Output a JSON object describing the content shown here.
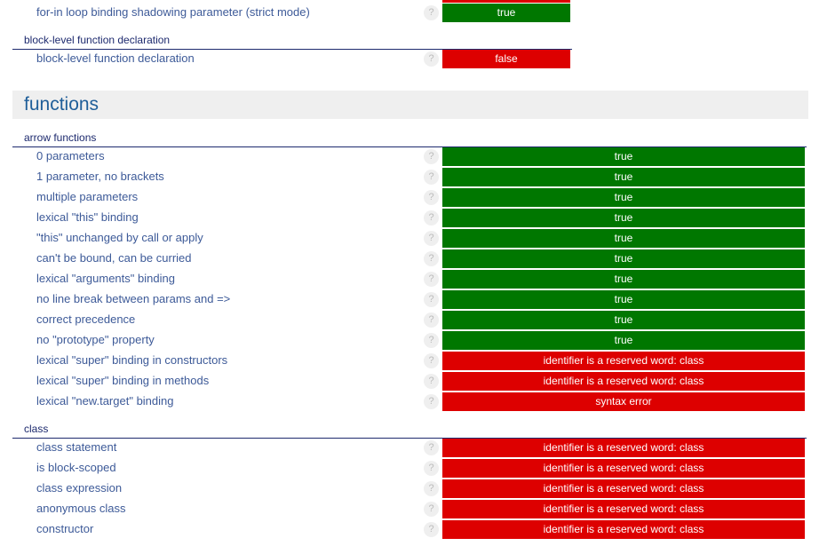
{
  "top": {
    "rows": [
      {
        "label": "for-in loop binding shadowing parameter (strict mode)",
        "result": "true",
        "status": "pass"
      }
    ]
  },
  "block_level": {
    "heading": "block-level function declaration",
    "rows": [
      {
        "label": "block-level function declaration",
        "result": "false",
        "status": "fail"
      }
    ]
  },
  "section": {
    "title": "functions"
  },
  "arrow_functions": {
    "heading": "arrow functions",
    "rows": [
      {
        "label": "0 parameters",
        "result": "true",
        "status": "pass"
      },
      {
        "label": "1 parameter, no brackets",
        "result": "true",
        "status": "pass"
      },
      {
        "label": "multiple parameters",
        "result": "true",
        "status": "pass"
      },
      {
        "label": "lexical \"this\" binding",
        "result": "true",
        "status": "pass"
      },
      {
        "label": "\"this\" unchanged by call or apply",
        "result": "true",
        "status": "pass"
      },
      {
        "label": "can't be bound, can be curried",
        "result": "true",
        "status": "pass"
      },
      {
        "label": "lexical \"arguments\" binding",
        "result": "true",
        "status": "pass"
      },
      {
        "label": "no line break between params and =>",
        "result": "true",
        "status": "pass"
      },
      {
        "label": "correct precedence",
        "result": "true",
        "status": "pass"
      },
      {
        "label": "no \"prototype\" property",
        "result": "true",
        "status": "pass"
      },
      {
        "label": "lexical \"super\" binding in constructors",
        "result": "identifier is a reserved word: class",
        "status": "fail"
      },
      {
        "label": "lexical \"super\" binding in methods",
        "result": "identifier is a reserved word: class",
        "status": "fail"
      },
      {
        "label": "lexical \"new.target\" binding",
        "result": "syntax error",
        "status": "fail"
      }
    ]
  },
  "class": {
    "heading": "class",
    "rows": [
      {
        "label": "class statement",
        "result": "identifier is a reserved word: class",
        "status": "fail"
      },
      {
        "label": "is block-scoped",
        "result": "identifier is a reserved word: class",
        "status": "fail"
      },
      {
        "label": "class expression",
        "result": "identifier is a reserved word: class",
        "status": "fail"
      },
      {
        "label": "anonymous class",
        "result": "identifier is a reserved word: class",
        "status": "fail"
      },
      {
        "label": "constructor",
        "result": "identifier is a reserved word: class",
        "status": "fail"
      }
    ]
  },
  "help_glyph": "?",
  "colors": {
    "pass": "#007700",
    "fail": "#dd0000",
    "heading": "#1d2a6e",
    "label": "#3d5a98"
  }
}
